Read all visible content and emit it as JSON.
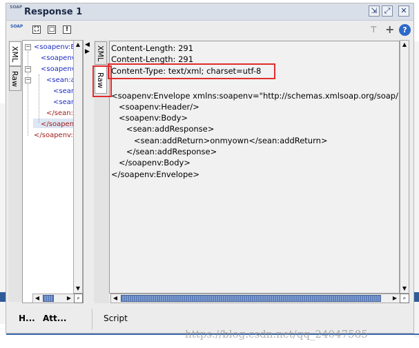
{
  "window": {
    "title": "Response 1"
  },
  "title_bar": {
    "logo_text": "SOAP",
    "buttons": [
      {
        "icon": "shrink-icon",
        "glyph": "⇲"
      },
      {
        "icon": "maximize-icon",
        "glyph": "⤢"
      },
      {
        "icon": "close-icon",
        "glyph": "✕"
      }
    ]
  },
  "toolbar": {
    "logo_text": "SOAP",
    "expand_glyph": "⛶",
    "restore_glyph": "□",
    "info_glyph": "!",
    "pin_glyph": "⊤",
    "add_glyph": "+",
    "help_glyph": "?"
  },
  "left_tabs": {
    "xml_label": "XML",
    "raw_label": "Raw"
  },
  "tree": {
    "rows": [
      "<soapenv:Envelope",
      "<soapenv:Header",
      "<soapenv:Body>",
      "<sean:addResp",
      "<sean:addRe",
      "<sean:addRe",
      "</sean:addResp",
      "</soapenv:Body>",
      "</soapenv:Envelope"
    ],
    "toggle_glyph": "−"
  },
  "splitter": {
    "left_glyph": "◀",
    "right_glyph": "▶"
  },
  "right_tabs": {
    "xml_label": "XML",
    "raw_label": "Raw"
  },
  "raw_content": {
    "lines": [
      "Content-Length: 291",
      "Content-Length: 291",
      "Content-Type: text/xml; charset=utf-8",
      "",
      "<soapenv:Envelope xmlns:soapenv=\"http://schemas.xmlsoap.org/soap/",
      "   <soapenv:Header/>",
      "   <soapenv:Body>",
      "      <sean:addResponse>",
      "         <sean:addReturn>onmyown</sean:addReturn>",
      "      </sean:addResponse>",
      "   </soapenv:Body>",
      "</soapenv:Envelope>"
    ]
  },
  "scrollbar": {
    "up": "▲",
    "down": "▼",
    "left": "◀",
    "right": "▶",
    "corner": "⌕"
  },
  "bottom_tabs": {
    "headers": "H...",
    "attachments": "Att...",
    "script": "Script"
  },
  "watermark": "https://blog.csdn.net/qq_24047585",
  "colors": {
    "annotation_red": "#e22b2b",
    "tree_open_tag": "#1b2abf",
    "tree_close_tag": "#a01b1b",
    "scroll_thumb": "#5576b0",
    "help_blue": "#2c69c9"
  }
}
